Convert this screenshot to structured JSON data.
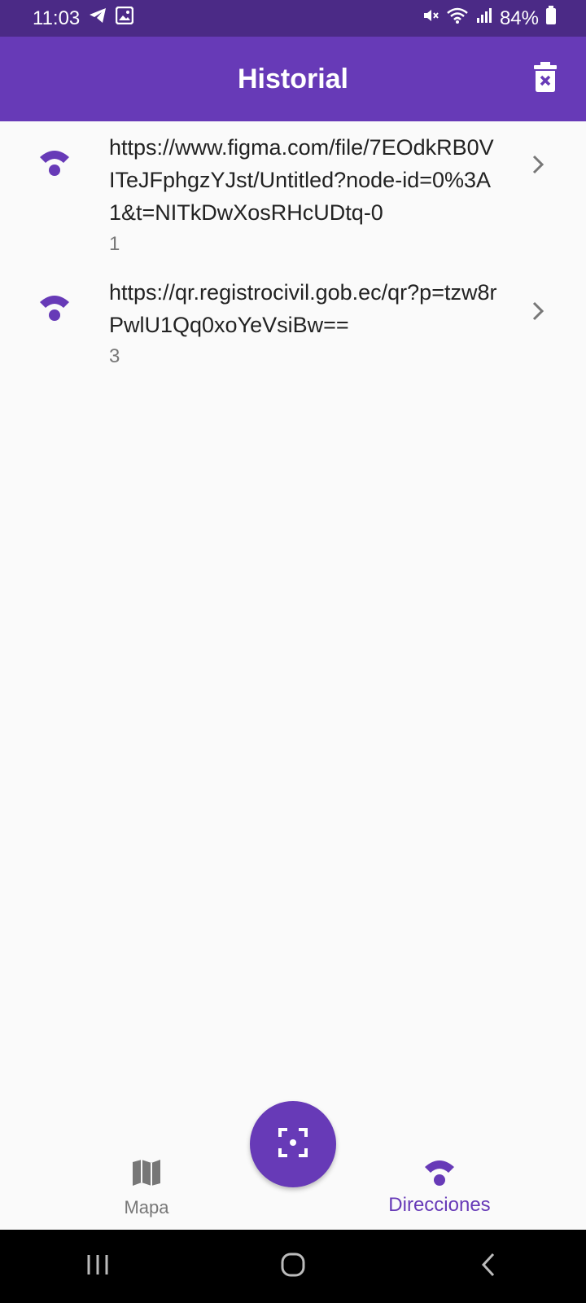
{
  "status_bar": {
    "time": "11:03",
    "battery": "84%"
  },
  "app_bar": {
    "title": "Historial",
    "delete_icon": "delete-sweep-icon"
  },
  "history": [
    {
      "url": "https://www.figma.com/file/7EOdkRB0VITeJFphgzYJst/Untitled?node-id=0%3A1&t=NITkDwXosRHcUDtq-0",
      "id": "1",
      "icon": "wifi-icon"
    },
    {
      "url": "https://qr.registrocivil.gob.ec/qr?p=tzw8rPwlU1Qq0xoYeVsiBw==",
      "id": "3",
      "icon": "wifi-icon"
    }
  ],
  "bottom_nav": {
    "map_label": "Mapa",
    "directions_label": "Direcciones",
    "active": "Direcciones"
  },
  "fab": {
    "icon": "scan-icon"
  },
  "colors": {
    "primary": "#673ab7",
    "status_bar": "#4b2a86",
    "background": "#fafafa"
  }
}
